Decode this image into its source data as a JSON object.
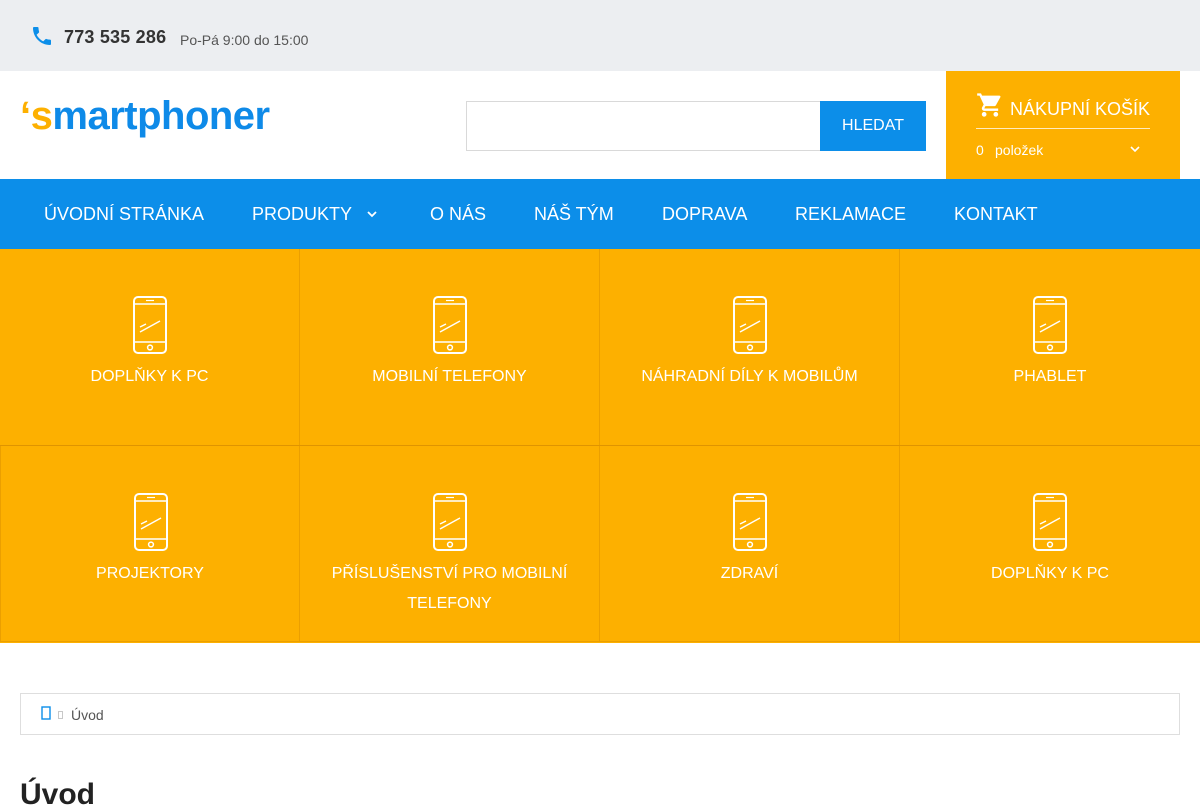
{
  "topbar": {
    "phone_icon": "phone-icon",
    "phone_number": "773 535 286",
    "hours": "Po-Pá 9:00 do 15:00"
  },
  "logo": {
    "apostrophe": "‘",
    "s": "s",
    "rest": "martphoner"
  },
  "search": {
    "value": "",
    "placeholder": "",
    "button_label": "HLEDAT"
  },
  "cart": {
    "icon": "cart-icon",
    "title": "NÁKUPNÍ KOŠÍK",
    "count": "0",
    "items_label": "položek"
  },
  "nav": {
    "items": [
      {
        "label": "ÚVODNÍ STRÁNKA",
        "has_dropdown": false
      },
      {
        "label": "PRODUKTY",
        "has_dropdown": true
      },
      {
        "label": "O NÁS",
        "has_dropdown": false
      },
      {
        "label": "NÁŠ TÝM",
        "has_dropdown": false
      },
      {
        "label": "DOPRAVA",
        "has_dropdown": false
      },
      {
        "label": "REKLAMACE",
        "has_dropdown": false
      },
      {
        "label": "KONTAKT",
        "has_dropdown": false
      }
    ]
  },
  "categories": [
    {
      "label": "DOPLŇKY K PC",
      "icon": "smartphone-icon"
    },
    {
      "label": "MOBILNÍ TELEFONY",
      "icon": "smartphone-icon"
    },
    {
      "label": "NÁHRADNÍ DÍLY K MOBILŮM",
      "icon": "smartphone-icon"
    },
    {
      "label": "PHABLET",
      "icon": "smartphone-icon"
    },
    {
      "label": "PROJEKTORY",
      "icon": "smartphone-icon"
    },
    {
      "label": "PŘÍSLUŠENSTVÍ PRO MOBILNÍ TELEFONY",
      "icon": "smartphone-icon"
    },
    {
      "label": "ZDRAVÍ",
      "icon": "smartphone-icon"
    },
    {
      "label": "DOPLŇKY K PC",
      "icon": "smartphone-icon"
    }
  ],
  "breadcrumb": {
    "home_icon": "home-icon",
    "current": "Úvod"
  },
  "page": {
    "heading": "Úvod"
  },
  "colors": {
    "brand_blue": "#0c8ee9",
    "brand_orange": "#fdb000",
    "topbar_bg": "#eceef1"
  }
}
